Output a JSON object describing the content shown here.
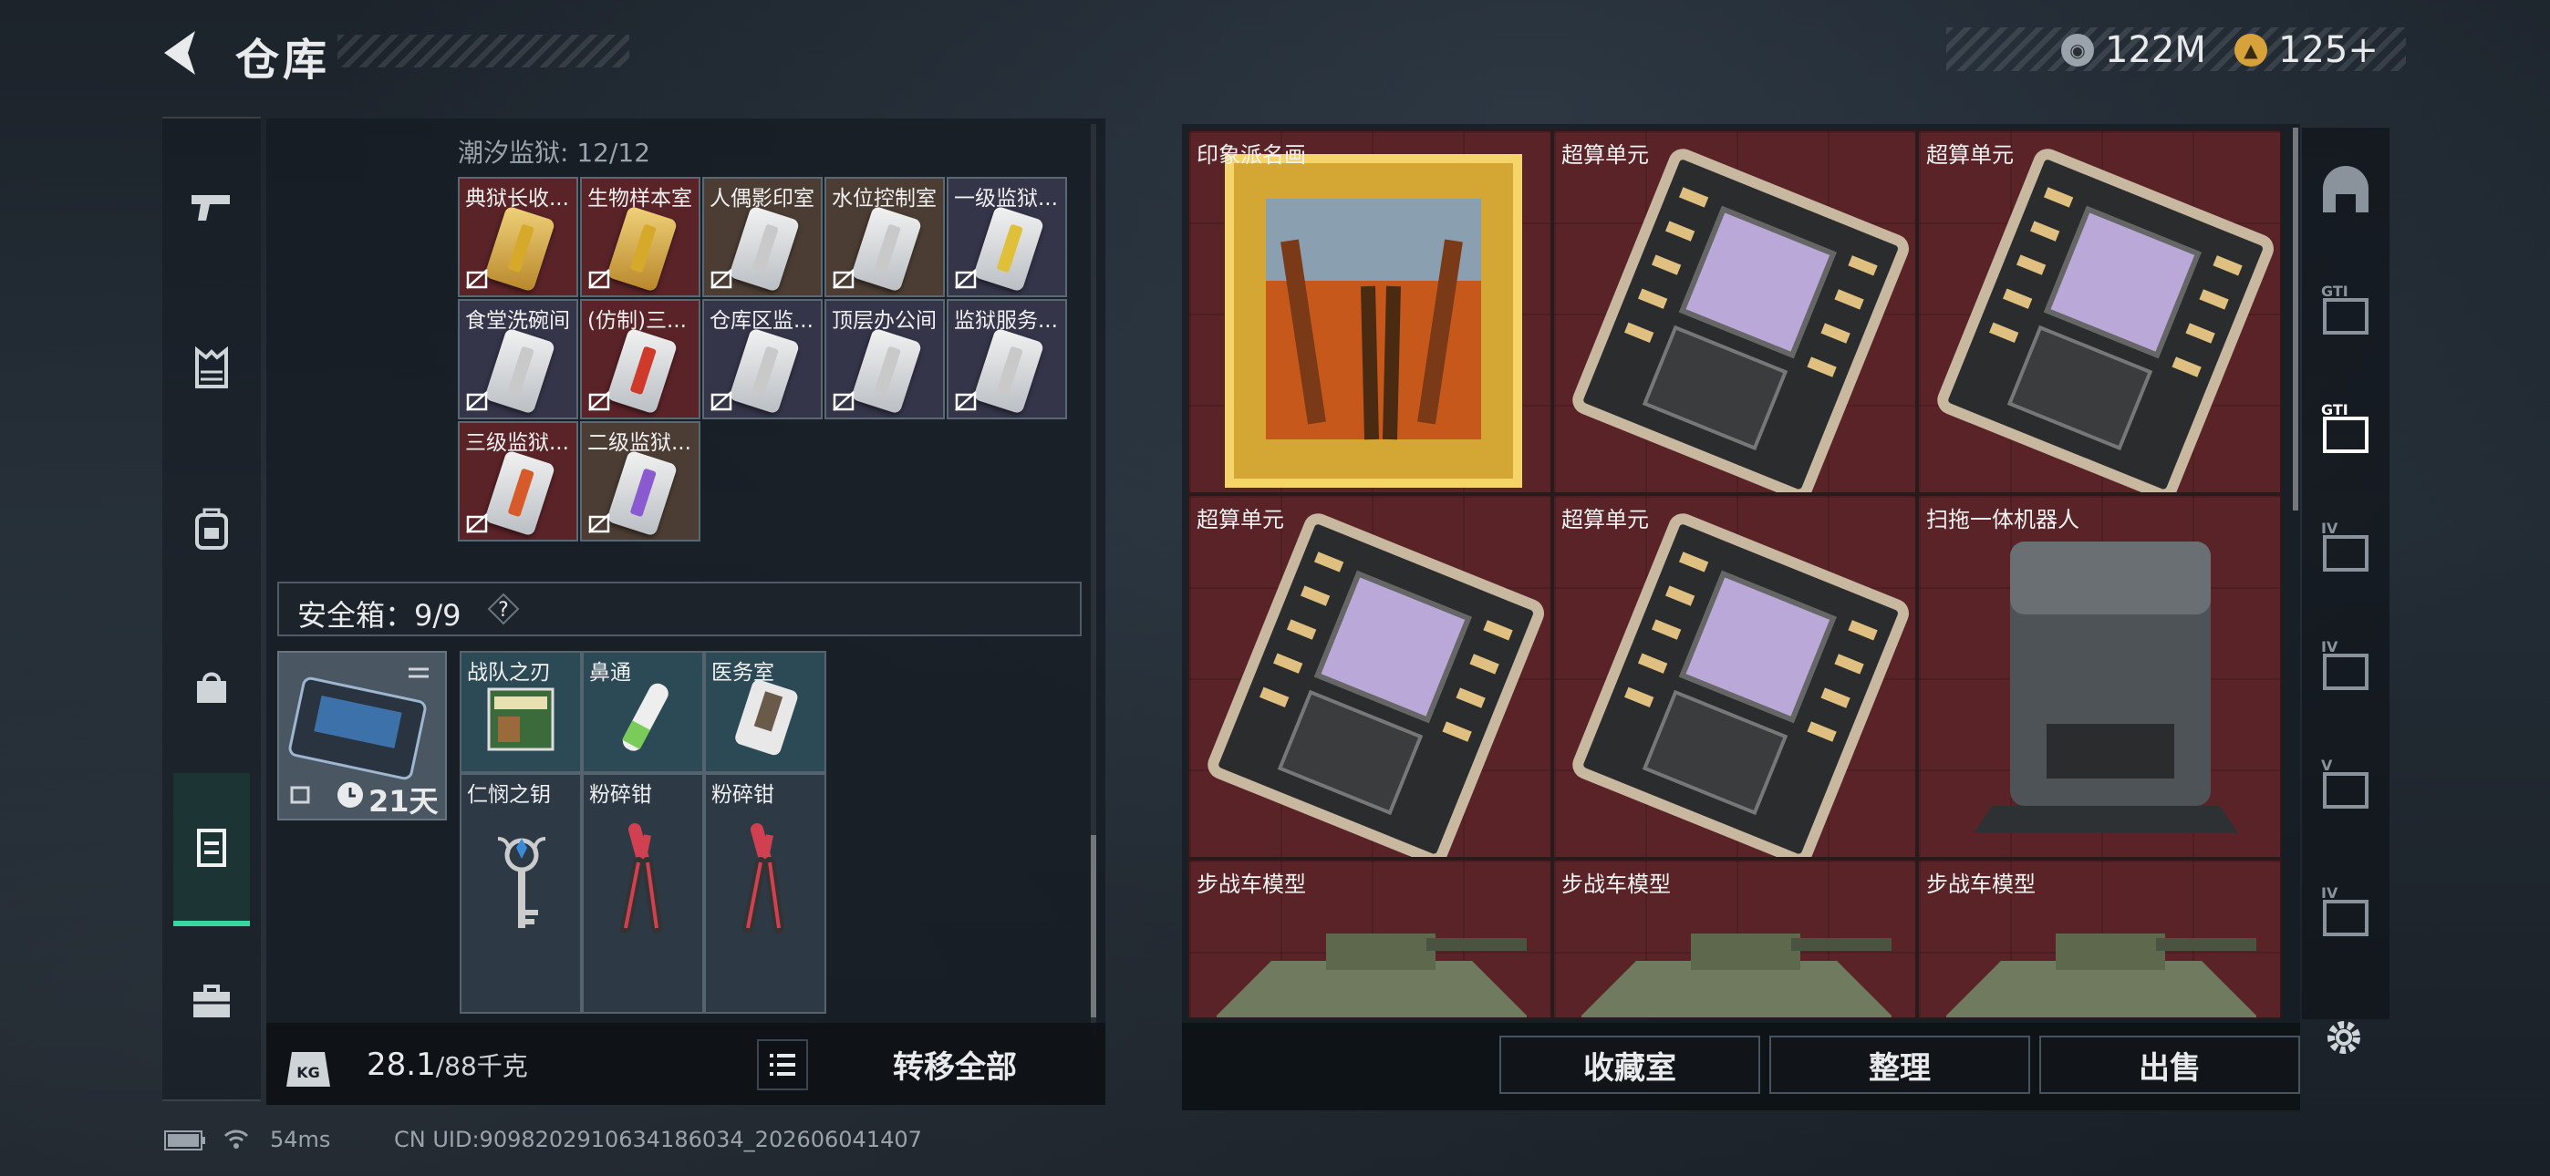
{
  "header": {
    "title": "仓库",
    "currency_silver": "122M",
    "currency_gold": "125+"
  },
  "left_nav": {
    "items": [
      "weapon-icon",
      "armor-icon",
      "backpack-icon",
      "bag-icon",
      "storage-icon",
      "case-icon"
    ],
    "active_index": 4
  },
  "prison_section": {
    "label": "潮汐监狱: 12/12",
    "items": [
      {
        "name": "典狱长收...",
        "bg": "#5a2328",
        "stripe": "#d7a92a",
        "gold": true
      },
      {
        "name": "生物样本室",
        "bg": "#5a2328",
        "stripe": "#d7a92a",
        "gold": true
      },
      {
        "name": "人偶影印室",
        "bg": "#4b3d33",
        "stripe": "#c9c9c9",
        "gold": false
      },
      {
        "name": "水位控制室",
        "bg": "#4b3d33",
        "stripe": "#c9c9c9",
        "gold": false
      },
      {
        "name": "一级监狱...",
        "bg": "#35354a",
        "stripe": "#e0c03a",
        "gold": false
      },
      {
        "name": "食堂洗碗间",
        "bg": "#35354a",
        "stripe": "#c9c9c9",
        "gold": false
      },
      {
        "name": "(仿制)三...",
        "bg": "#5a2328",
        "stripe": "#d03a2a",
        "gold": false
      },
      {
        "name": "仓库区监...",
        "bg": "#35354a",
        "stripe": "#c9c9c9",
        "gold": false
      },
      {
        "name": "顶层办公间",
        "bg": "#35354a",
        "stripe": "#c9c9c9",
        "gold": false
      },
      {
        "name": "监狱服务...",
        "bg": "#35354a",
        "stripe": "#c9c9c9",
        "gold": false
      },
      {
        "name": "三级监狱...",
        "bg": "#5a2328",
        "stripe": "#d65a2a",
        "gold": false
      },
      {
        "name": "二级监狱...",
        "bg": "#4b3d33",
        "stripe": "#8a5ad0",
        "gold": false
      }
    ]
  },
  "safe_box": {
    "label": "安全箱：9/9",
    "help": "?",
    "timer": "21天",
    "items": [
      {
        "name": "战队之刃",
        "icon": "book-icon",
        "bg": "#2c4a55"
      },
      {
        "name": "鼻通",
        "icon": "nasal-inhaler-icon",
        "bg": "#2c4a55"
      },
      {
        "name": "医务室",
        "icon": "keycard-icon",
        "bg": "#2c4a55"
      },
      {
        "name": "仁悯之钥",
        "icon": "ornate-key-icon",
        "bg": "#2d3a46"
      },
      {
        "name": "粉碎钳",
        "icon": "pliers-icon",
        "bg": "#2d3a46"
      },
      {
        "name": "粉碎钳",
        "icon": "pliers-icon",
        "bg": "#2d3a46"
      }
    ]
  },
  "bottom_bar": {
    "weight_current": "28.1",
    "weight_max": "/88千克",
    "transfer_label": "转移全部"
  },
  "right_panel": {
    "items": [
      {
        "name": "印象派名画",
        "icon": "framed-painting-icon"
      },
      {
        "name": "超算单元",
        "icon": "circuit-board-icon"
      },
      {
        "name": "超算单元",
        "icon": "circuit-board-icon"
      },
      {
        "name": "超算单元",
        "icon": "circuit-board-icon"
      },
      {
        "name": "超算单元",
        "icon": "circuit-board-icon"
      },
      {
        "name": "扫拖一体机器人",
        "icon": "robot-vacuum-icon"
      },
      {
        "name": "步战车模型",
        "icon": "armored-vehicle-icon"
      },
      {
        "name": "步战车模型",
        "icon": "armored-vehicle-icon"
      },
      {
        "name": "步战车模型",
        "icon": "armored-vehicle-icon"
      }
    ],
    "buttons": {
      "collection": "收藏室",
      "organize": "整理",
      "sell": "出售"
    }
  },
  "right_nav": {
    "items": [
      "helmet-icon",
      "gti-map-icon",
      "gti-hand-icon",
      "iv-folder-icon",
      "iv-hand-icon",
      "v-monitor-icon",
      "iv-chart-icon"
    ],
    "labels": [
      "",
      "GTI",
      "GTI",
      "IV",
      "IV",
      "V",
      "IV"
    ]
  },
  "footer": {
    "ping": "54ms",
    "uid": "CN UID:9098202910634186034_202606041407"
  }
}
